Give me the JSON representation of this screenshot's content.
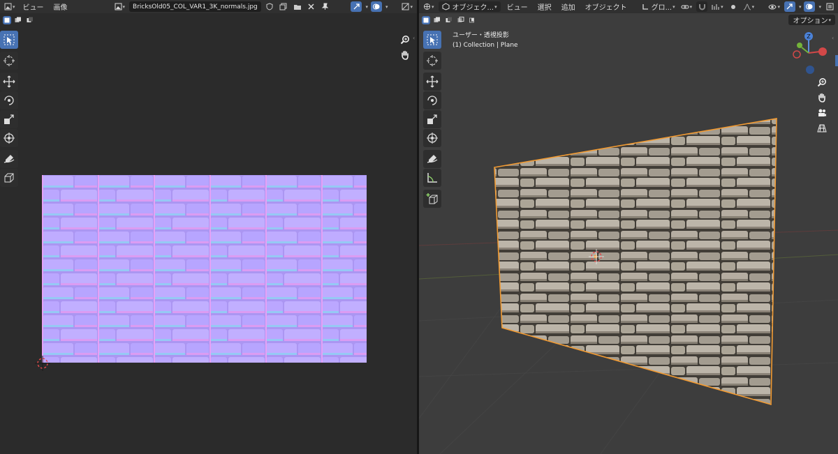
{
  "image_editor": {
    "menus": [
      "ビュー",
      "画像"
    ],
    "filename": "BricksOld05_COL_VAR1_3K_normals.jpg",
    "accent": "#4772b3"
  },
  "viewport": {
    "mode": "オブジェク...",
    "menus": [
      "ビュー",
      "選択",
      "追加",
      "オブジェクト"
    ],
    "orientation": "グロ...",
    "options_label": "オプション",
    "view_name": "ユーザー・透視投影",
    "collection_info": "(1) Collection | Plane",
    "axis_z": "Z",
    "selection_color": "#f29b33"
  },
  "icons": {
    "image_editor_toolbar": [
      "select-box-icon",
      "cursor-icon",
      "move-icon",
      "rotate-icon",
      "scale-icon",
      "transform-icon",
      "annotate-icon",
      "sample-icon"
    ],
    "viewport_toolbar": [
      "select-box-icon",
      "cursor-icon",
      "move-icon",
      "rotate-icon",
      "scale-icon",
      "transform-icon",
      "annotate-icon",
      "measure-icon",
      "add-cube-icon"
    ]
  }
}
